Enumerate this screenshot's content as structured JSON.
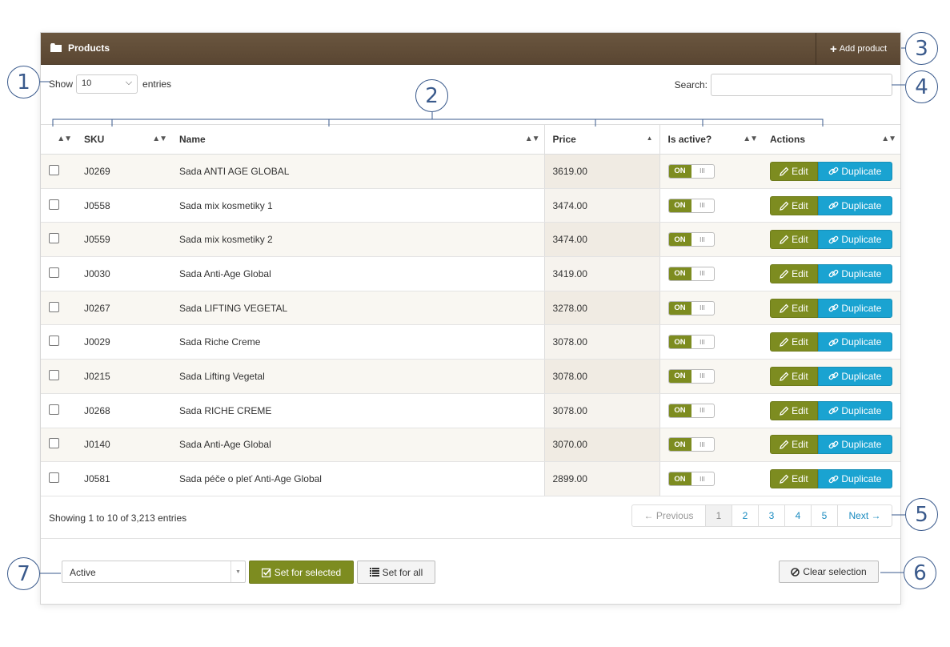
{
  "header": {
    "title": "Products",
    "add_product_label": "Add product"
  },
  "length_menu": {
    "show_label": "Show",
    "value": "10",
    "entries_label": "entries"
  },
  "search": {
    "label": "Search:",
    "value": ""
  },
  "table": {
    "columns": [
      "",
      "SKU",
      "Name",
      "Price",
      "Is active?",
      "Actions"
    ],
    "rows": [
      {
        "sku": "J0269",
        "name": "Sada ANTI AGE GLOBAL",
        "price": "3619.00",
        "active": "ON"
      },
      {
        "sku": "J0558",
        "name": "Sada mix kosmetiky 1",
        "price": "3474.00",
        "active": "ON"
      },
      {
        "sku": "J0559",
        "name": "Sada mix kosmetiky 2",
        "price": "3474.00",
        "active": "ON"
      },
      {
        "sku": "J0030",
        "name": "Sada Anti-Age Global",
        "price": "3419.00",
        "active": "ON"
      },
      {
        "sku": "J0267",
        "name": "Sada LIFTING VEGETAL",
        "price": "3278.00",
        "active": "ON"
      },
      {
        "sku": "J0029",
        "name": "Sada Riche Creme",
        "price": "3078.00",
        "active": "ON"
      },
      {
        "sku": "J0215",
        "name": "Sada Lifting Vegetal",
        "price": "3078.00",
        "active": "ON"
      },
      {
        "sku": "J0268",
        "name": "Sada RICHE CREME",
        "price": "3078.00",
        "active": "ON"
      },
      {
        "sku": "J0140",
        "name": "Sada Anti-Age Global",
        "price": "3070.00",
        "active": "ON"
      },
      {
        "sku": "J0581",
        "name": "Sada péče o pleť Anti-Age Global",
        "price": "2899.00",
        "active": "ON"
      }
    ],
    "edit_label": "Edit",
    "duplicate_label": "Duplicate"
  },
  "info": "Showing 1 to 10 of 3,213 entries",
  "pagination": {
    "previous": "← Previous",
    "pages": [
      "1",
      "2",
      "3",
      "4",
      "5"
    ],
    "current": "1",
    "next": "Next →"
  },
  "bulk": {
    "status_value": "Active",
    "set_selected_label": "Set for selected",
    "set_all_label": "Set for all",
    "clear_label": "Clear selection"
  },
  "callouts": [
    "1",
    "2",
    "3",
    "4",
    "5",
    "6",
    "7"
  ],
  "colors": {
    "header_bg": "#5f4b36",
    "olive": "#7d8c20",
    "blue": "#1aa3d1",
    "callout": "#3a5a8c"
  }
}
